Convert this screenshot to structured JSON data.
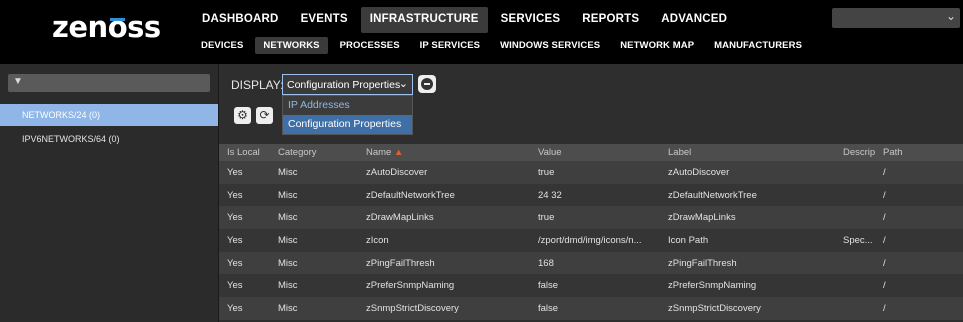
{
  "logo": {
    "text_a": "zen",
    "text_o": "o",
    "text_b": "ss"
  },
  "mainnav": {
    "items": [
      {
        "label": "DASHBOARD"
      },
      {
        "label": "EVENTS"
      },
      {
        "label": "INFRASTRUCTURE"
      },
      {
        "label": "SERVICES"
      },
      {
        "label": "REPORTS"
      },
      {
        "label": "ADVANCED"
      }
    ]
  },
  "subnav": {
    "items": [
      {
        "label": "DEVICES"
      },
      {
        "label": "NETWORKS"
      },
      {
        "label": "PROCESSES"
      },
      {
        "label": "IP SERVICES"
      },
      {
        "label": "WINDOWS SERVICES"
      },
      {
        "label": "NETWORK MAP"
      },
      {
        "label": "MANUFACTURERS"
      }
    ]
  },
  "sidebar": {
    "items": [
      {
        "label": "NETWORKS/24 (0)"
      },
      {
        "label": "IPV6NETWORKS/64 (0)"
      }
    ]
  },
  "display": {
    "label": "DISPLAY:",
    "selected": "Configuration Properties",
    "options": [
      "IP Addresses",
      "Configuration Properties"
    ]
  },
  "table": {
    "columns": [
      "Is Local",
      "Category",
      "Name",
      "Value",
      "Label",
      "Descrip",
      "Path"
    ],
    "sort_arrow": "▲",
    "rows": [
      [
        "Yes",
        "Misc",
        "zAutoDiscover",
        "true",
        "zAutoDiscover",
        "",
        "/"
      ],
      [
        "Yes",
        "Misc",
        "zDefaultNetworkTree",
        "24 32",
        "zDefaultNetworkTree",
        "",
        "/"
      ],
      [
        "Yes",
        "Misc",
        "zDrawMapLinks",
        "true",
        "zDrawMapLinks",
        "",
        "/"
      ],
      [
        "Yes",
        "Misc",
        "zIcon",
        "/zport/dmd/img/icons/n...",
        "Icon Path",
        "Spec...",
        "/"
      ],
      [
        "Yes",
        "Misc",
        "zPingFailThresh",
        "168",
        "zPingFailThresh",
        "",
        "/"
      ],
      [
        "Yes",
        "Misc",
        "zPreferSnmpNaming",
        "false",
        "zPreferSnmpNaming",
        "",
        "/"
      ],
      [
        "Yes",
        "Misc",
        "zSnmpStrictDiscovery",
        "false",
        "zSnmpStrictDiscovery",
        "",
        "/"
      ]
    ]
  },
  "icons": {
    "filter": "funnel-icon",
    "chevron": "chevron-down-icon",
    "settings": "gear-icon",
    "refresh": "refresh-icon",
    "remove": "minus-circle-icon"
  },
  "colors": {
    "accent": "#8fb6e6",
    "selected_option": "#3e6fa6",
    "sort_arrow": "#e0602f"
  }
}
